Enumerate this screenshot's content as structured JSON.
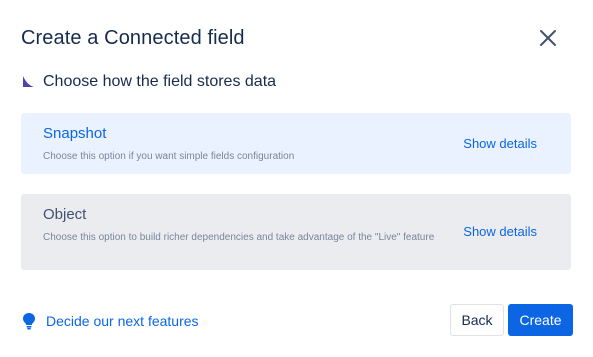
{
  "dialog": {
    "title": "Create a Connected field",
    "close_icon": "close-icon"
  },
  "section": {
    "label": "Choose how the field stores data",
    "icon": "corner-marker-icon",
    "icon_color": "#5243aa"
  },
  "options": [
    {
      "title": "Snapshot",
      "description": "Choose this option if you want simple fields configuration",
      "link": "Show details",
      "selected": true
    },
    {
      "title": "Object",
      "description": "Choose this option to build richer dependencies and take advantage of the \"Live\" feature",
      "link": "Show details",
      "selected": false
    }
  ],
  "footer": {
    "feedback_link": "Decide our next features",
    "feedback_icon": "lightbulb-icon",
    "back_label": "Back",
    "create_label": "Create"
  },
  "colors": {
    "accent": "#0c66e4",
    "selected_bg": "#e9f2fe",
    "unselected_bg": "#ebecf0",
    "text": "#172b4d"
  }
}
